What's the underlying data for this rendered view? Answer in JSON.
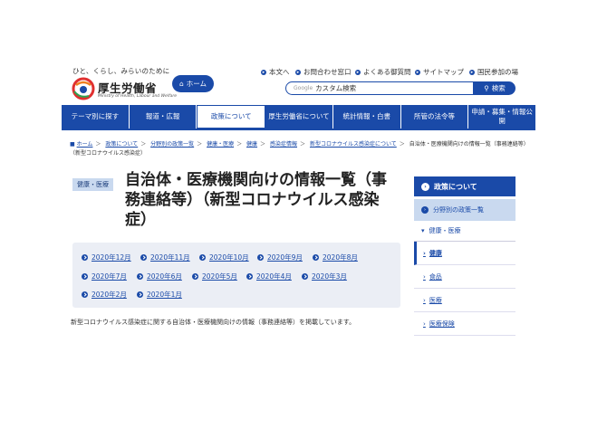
{
  "header": {
    "tagline": "ひと、くらし、みらいのために",
    "logo_text": "厚生労働省",
    "logo_sub": "Ministry of Health, Labour and Welfare",
    "home_label": "ホーム",
    "utility_links": [
      "本文へ",
      "お問合わせ窓口",
      "よくある御質問",
      "サイトマップ",
      "国民参加の場"
    ],
    "search_placeholder": "カスタム検索",
    "search_google": "Google",
    "search_button": "検索"
  },
  "nav": {
    "items": [
      "テーマ別に探す",
      "報道・広報",
      "政策について",
      "厚生労働省について",
      "統計情報・白書",
      "所管の法令等",
      "申請・募集・情報公開"
    ],
    "active_index": 2
  },
  "breadcrumb": {
    "items": [
      "ホーム",
      "政策について",
      "分野別の政策一覧",
      "健康・医療",
      "健康",
      "感染症情報",
      "新型コロナウイルス感染症について"
    ],
    "current": "自治体・医療機関向けの情報一覧（事務連絡等）（新型コロナウイルス感染症）"
  },
  "main": {
    "badge": "健康・医療",
    "title": "自治体・医療機関向けの情報一覧（事務連絡等）（新型コロナウイルス感染症）",
    "months": [
      "2020年12月",
      "2020年11月",
      "2020年10月",
      "2020年9月",
      "2020年8月",
      "2020年7月",
      "2020年6月",
      "2020年5月",
      "2020年4月",
      "2020年3月",
      "2020年2月",
      "2020年1月"
    ],
    "body": "新型コロナウイルス感染症に関する自治体・医療機関向けの情報（事務連絡等）を掲載しています。"
  },
  "sidebar": {
    "head": "政策について",
    "level1": "分野別の政策一覧",
    "level2": "健康・医療",
    "items": [
      "健康",
      "食品",
      "医療",
      "医療保険"
    ]
  },
  "colors": {
    "primary": "#1a4aa8",
    "light": "#c9d9ef",
    "panel": "#ebeef5"
  }
}
